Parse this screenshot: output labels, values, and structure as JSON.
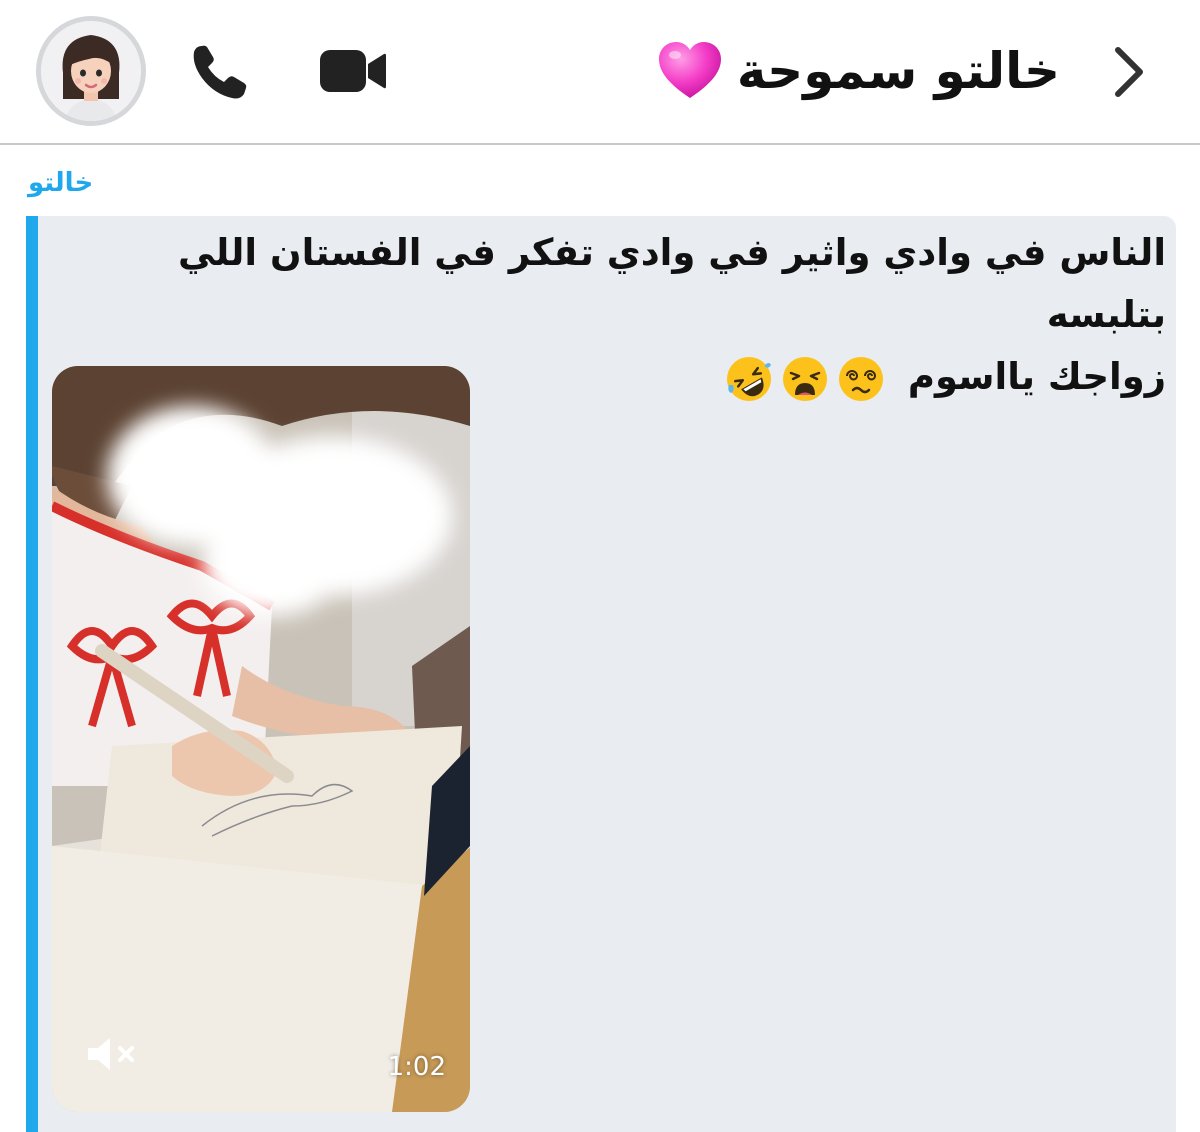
{
  "header": {
    "contact_name": "خالتو سموحة",
    "heart_icon": "pink-heart-emoji",
    "back_icon": "chevron-right-icon",
    "call_icon": "phone-icon",
    "video_icon": "video-camera-icon",
    "avatar_icon": "bitmoji-avatar"
  },
  "message": {
    "sender": "خالتو",
    "text_line1": "الناس في وادي واثير في وادي تفكر في الفستان اللي بتلبسه",
    "text_line2": "زواجك يااسوم",
    "emojis": [
      "dizzy-face-emoji",
      "weary-face-emoji",
      "rolling-on-floor-laughing-emoji"
    ],
    "accent_color": "#1fa8ec"
  },
  "video": {
    "duration": "1:02",
    "muted": true,
    "mute_icon": "speaker-muted-icon"
  }
}
